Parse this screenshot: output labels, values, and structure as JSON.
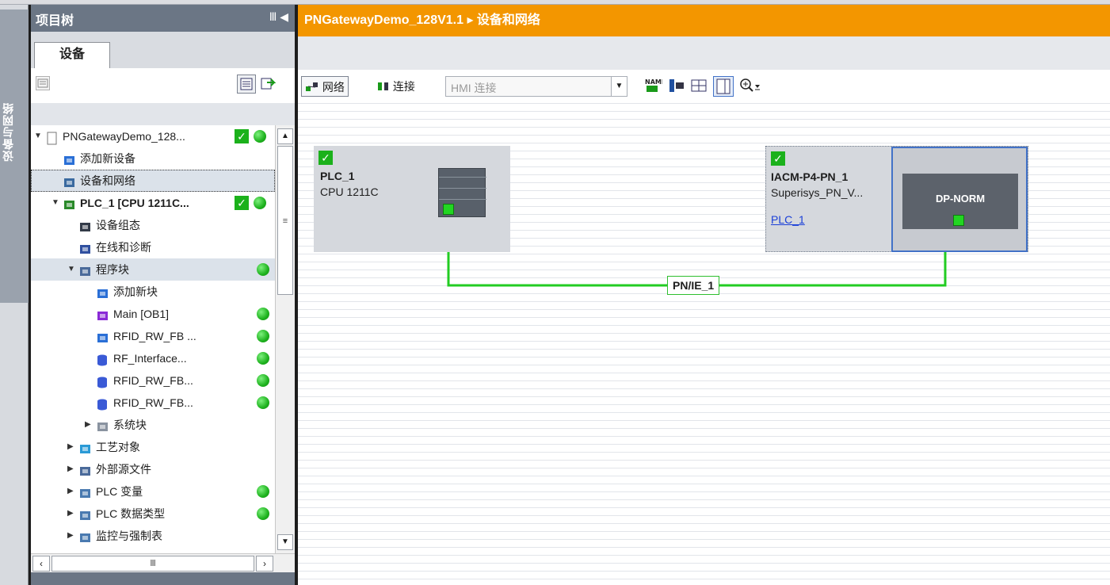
{
  "vertical_tab": {
    "label": "设备与网络"
  },
  "project_tree": {
    "title": "项目树",
    "header_controls": "Ⅲ ◀",
    "tab": "设备",
    "items": [
      {
        "label": "PNGatewayDemo_128...",
        "level": 0,
        "arrow": "▼",
        "icon": "project-icon",
        "check": true,
        "dot": true
      },
      {
        "label": "添加新设备",
        "level": 1,
        "arrow": "",
        "icon": "add-device-icon"
      },
      {
        "label": "设备和网络",
        "level": 1,
        "arrow": "",
        "icon": "network-icon",
        "selected": true
      },
      {
        "label": "PLC_1 [CPU 1211C...",
        "level": 1,
        "arrow": "▼",
        "icon": "plc-icon",
        "check": true,
        "dot": true,
        "bold": true
      },
      {
        "label": "设备组态",
        "level": 2,
        "arrow": "",
        "icon": "device-config-icon"
      },
      {
        "label": "在线和诊断",
        "level": 2,
        "arrow": "",
        "icon": "diagnostics-icon"
      },
      {
        "label": "程序块",
        "level": 2,
        "arrow": "▼",
        "icon": "program-blocks-icon",
        "dot": true,
        "selected": true
      },
      {
        "label": "添加新块",
        "level": 3,
        "arrow": "",
        "icon": "add-block-icon"
      },
      {
        "label": "Main [OB1]",
        "level": 3,
        "arrow": "",
        "icon": "ob-block-icon",
        "dot": true
      },
      {
        "label": "RFID_RW_FB ...",
        "level": 3,
        "arrow": "",
        "icon": "fb-block-icon",
        "dot": true
      },
      {
        "label": "RF_Interface...",
        "level": 3,
        "arrow": "",
        "icon": "db-block-icon",
        "dot": true
      },
      {
        "label": "RFID_RW_FB...",
        "level": 3,
        "arrow": "",
        "icon": "db-block-icon",
        "dot": true
      },
      {
        "label": "RFID_RW_FB...",
        "level": 3,
        "arrow": "",
        "icon": "db-block-icon",
        "dot": true
      },
      {
        "label": "系统块",
        "level": 3,
        "arrow": "▶",
        "icon": "system-blocks-icon"
      },
      {
        "label": "工艺对象",
        "level": 2,
        "arrow": "▶",
        "icon": "technology-objects-icon"
      },
      {
        "label": "外部源文件",
        "level": 2,
        "arrow": "▶",
        "icon": "external-source-icon"
      },
      {
        "label": "PLC 变量",
        "level": 2,
        "arrow": "▶",
        "icon": "plc-tags-icon",
        "dot": true
      },
      {
        "label": "PLC 数据类型",
        "level": 2,
        "arrow": "▶",
        "icon": "plc-datatypes-icon",
        "dot": true
      },
      {
        "label": "监控与强制表",
        "level": 2,
        "arrow": "▶",
        "icon": "watch-tables-icon"
      }
    ],
    "scroll_glyph": "≡",
    "hscroll_glyph": "Ⅲ"
  },
  "editor": {
    "breadcrumb": "PNGatewayDemo_128V1.1 ▸ 设备和网络",
    "toolbar": {
      "network_label": "网络",
      "connection_label": "连接",
      "hmi_select": "HMI 连接"
    },
    "network": {
      "label": "PN/IE_1",
      "line_color": "#22cc22"
    },
    "devices": [
      {
        "name": "PLC_1",
        "type": "CPU 1211C",
        "check": true
      },
      {
        "name": "IACM-P4-PN_1",
        "type": "Superisys_PN_V...",
        "link": "PLC_1",
        "module_label": "DP-NORM",
        "check": true
      }
    ]
  },
  "colors": {
    "accent": "#f39600",
    "tree_header": "#6b7685",
    "ok_green": "#1bb11b",
    "link_blue": "#1a3fd8"
  }
}
